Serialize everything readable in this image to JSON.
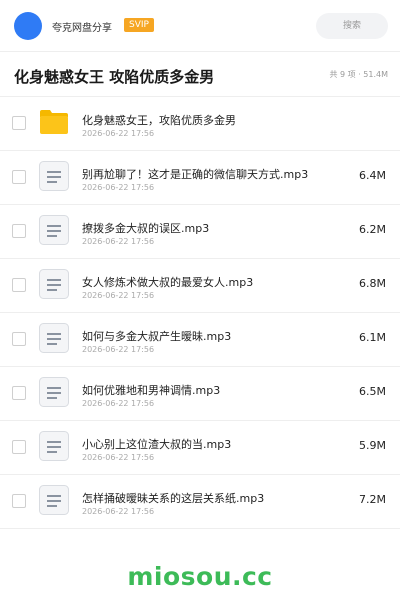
{
  "header": {
    "owner_name": "夸克网盘分享",
    "badge": "SVIP",
    "search_placeholder": "搜索"
  },
  "folder": {
    "title": "化身魅惑女王 攻陷优质多金男",
    "meta": "共 9 项 · 51.4M"
  },
  "files": [
    {
      "name": "化身魅惑女王，攻陷优质多金男",
      "date": "2026-06-22 17:56",
      "size": "",
      "icon": "folder-icon"
    },
    {
      "name": "别再尬聊了！这才是正确的微信聊天方式.mp3",
      "date": "2026-06-22 17:56",
      "size": "6.4M",
      "icon": "audio-file-icon"
    },
    {
      "name": "撩拨多金大叔的误区.mp3",
      "date": "2026-06-22 17:56",
      "size": "6.2M",
      "icon": "audio-file-icon"
    },
    {
      "name": "女人修炼术做大叔的最爱女人.mp3",
      "date": "2026-06-22 17:56",
      "size": "6.8M",
      "icon": "audio-file-icon"
    },
    {
      "name": "如何与多金大叔产生暧昧.mp3",
      "date": "2026-06-22 17:56",
      "size": "6.1M",
      "icon": "audio-file-icon"
    },
    {
      "name": "如何优雅地和男神调情.mp3",
      "date": "2026-06-22 17:56",
      "size": "6.5M",
      "icon": "audio-file-icon"
    },
    {
      "name": "小心别上这位渣大叔的当.mp3",
      "date": "2026-06-22 17:56",
      "size": "5.9M",
      "icon": "audio-file-icon"
    },
    {
      "name": "怎样捅破暧昧关系的这层关系纸.mp3",
      "date": "2026-06-22 17:56",
      "size": "7.2M",
      "icon": "audio-file-icon"
    }
  ],
  "watermark": "miosou.cc",
  "colors": {
    "accent": "#2f7bf5",
    "badge": "#f6a623",
    "folder": "#fcc419",
    "watermark": "#3dbb58"
  }
}
